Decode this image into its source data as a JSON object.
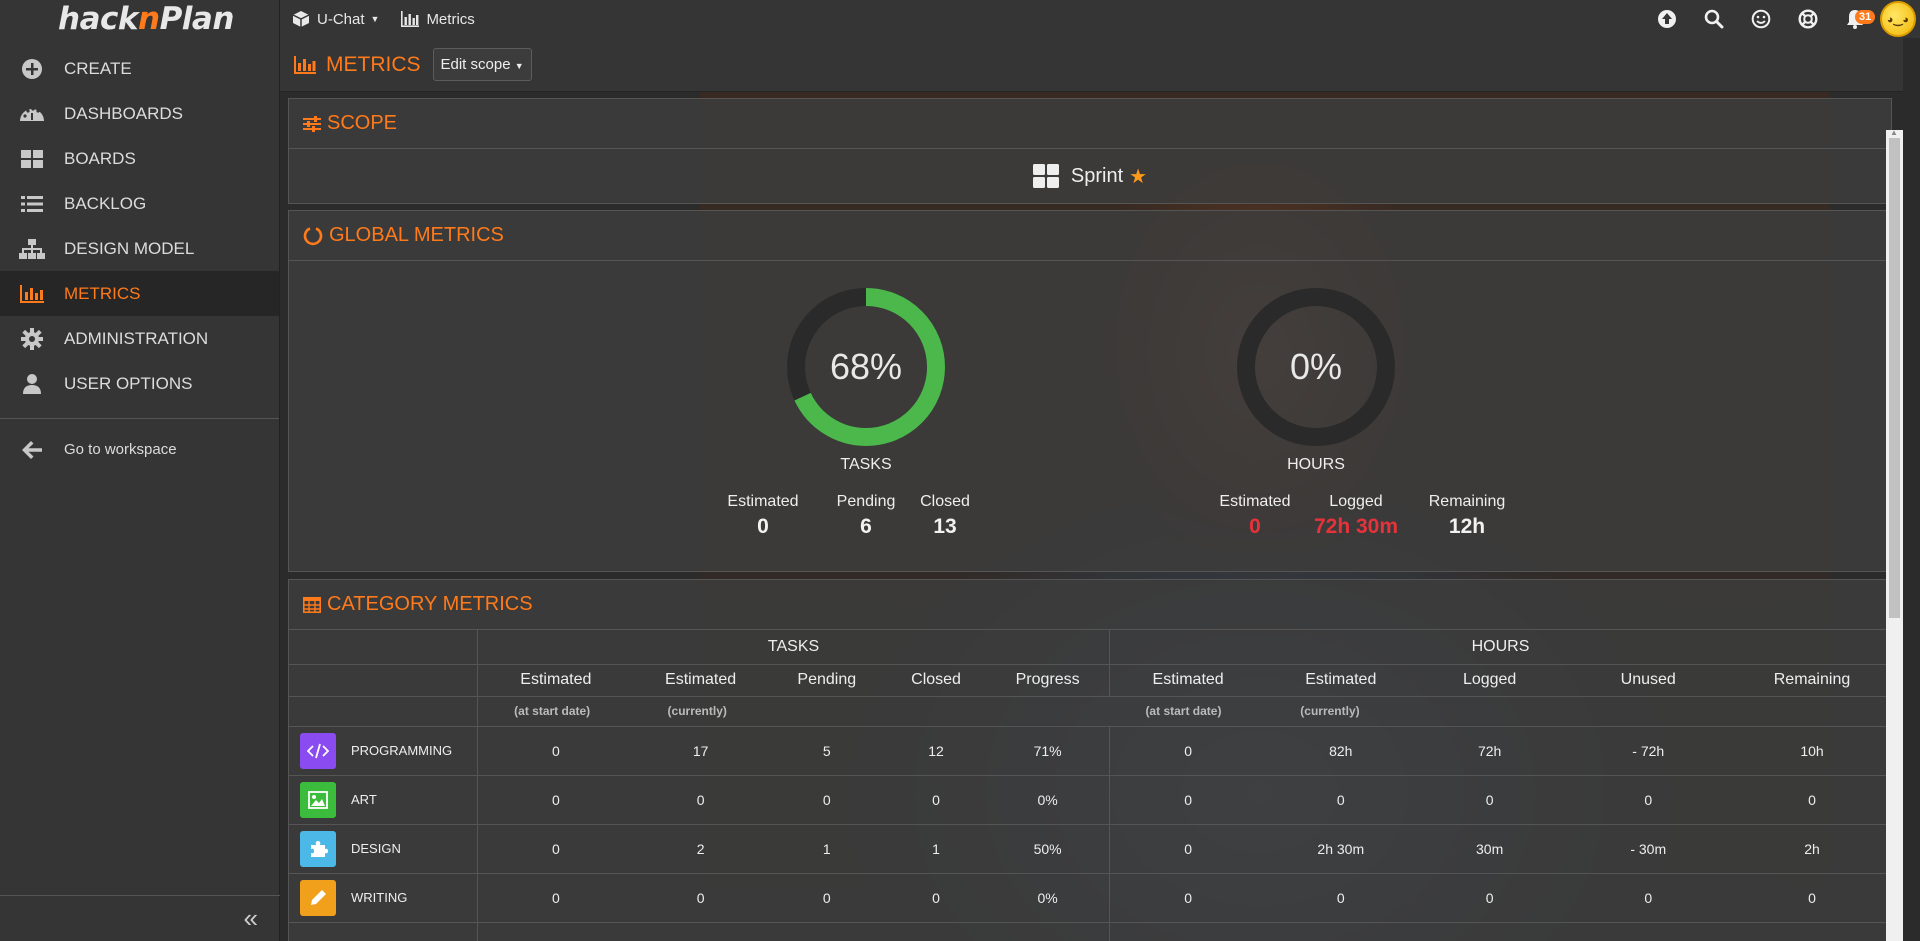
{
  "app": {
    "logo_prefix": "hack",
    "logo_n": "n",
    "logo_suffix": "Plan"
  },
  "sidebar": {
    "items": [
      {
        "label": "CREATE",
        "icon": "plus-circle-icon"
      },
      {
        "label": "DASHBOARDS",
        "icon": "dashboard-icon"
      },
      {
        "label": "BOARDS",
        "icon": "boards-icon"
      },
      {
        "label": "BACKLOG",
        "icon": "list-icon"
      },
      {
        "label": "DESIGN MODEL",
        "icon": "sitemap-icon"
      },
      {
        "label": "METRICS",
        "icon": "bar-chart-icon",
        "active": true
      },
      {
        "label": "ADMINISTRATION",
        "icon": "gear-icon"
      },
      {
        "label": "USER OPTIONS",
        "icon": "user-icon"
      }
    ],
    "workspace_label": "Go to workspace",
    "collapse_glyph": "«"
  },
  "topbar": {
    "project": "U-Chat",
    "section": "Metrics",
    "notification_count": "31",
    "icons": [
      "upload-icon",
      "search-icon",
      "smile-icon",
      "lifebuoy-icon",
      "bell-icon"
    ]
  },
  "page": {
    "title": "METRICS",
    "edit_scope": "Edit scope"
  },
  "scope": {
    "title": "SCOPE",
    "value": "Sprint"
  },
  "global": {
    "title": "GLOBAL METRICS",
    "tasks": {
      "percent": "68%",
      "fraction": 0.68,
      "label": "TASKS",
      "estimated_label": "Estimated",
      "estimated": "0",
      "pending_label": "Pending",
      "pending": "6",
      "closed_label": "Closed",
      "closed": "13"
    },
    "hours": {
      "percent": "0%",
      "fraction": 0,
      "label": "HOURS",
      "estimated_label": "Estimated",
      "estimated": "0",
      "logged_label": "Logged",
      "logged": "72h 30m",
      "remaining_label": "Remaining",
      "remaining": "12h"
    },
    "colors": {
      "progress": "#4cb84c",
      "track": "#2a2a2a",
      "alert": "#e8323a"
    }
  },
  "category": {
    "title": "CATEGORY METRICS",
    "group_tasks": "TASKS",
    "group_hours": "HOURS",
    "headers": [
      "Estimated",
      "Estimated",
      "Pending",
      "Closed",
      "Progress",
      "Estimated",
      "Estimated",
      "Logged",
      "Unused",
      "Remaining"
    ],
    "notes": {
      "start": "(at start date)",
      "current": "(currently)"
    },
    "rows": [
      {
        "name": "PROGRAMMING",
        "icon": "code-icon",
        "color": "#8a4cf0",
        "values": [
          "0",
          "17",
          "5",
          "12",
          "71%",
          "0",
          "82h",
          "72h",
          "- 72h",
          "10h"
        ]
      },
      {
        "name": "ART",
        "icon": "image-icon",
        "color": "#3cbc3c",
        "values": [
          "0",
          "0",
          "0",
          "0",
          "0%",
          "0",
          "0",
          "0",
          "0",
          "0"
        ]
      },
      {
        "name": "DESIGN",
        "icon": "puzzle-icon",
        "color": "#4cb8e8",
        "values": [
          "0",
          "2",
          "1",
          "1",
          "50%",
          "0",
          "2h 30m",
          "30m",
          "- 30m",
          "2h"
        ]
      },
      {
        "name": "WRITING",
        "icon": "pencil-icon",
        "color": "#f0a01a",
        "values": [
          "0",
          "0",
          "0",
          "0",
          "0%",
          "0",
          "0",
          "0",
          "0",
          "0"
        ]
      }
    ]
  }
}
